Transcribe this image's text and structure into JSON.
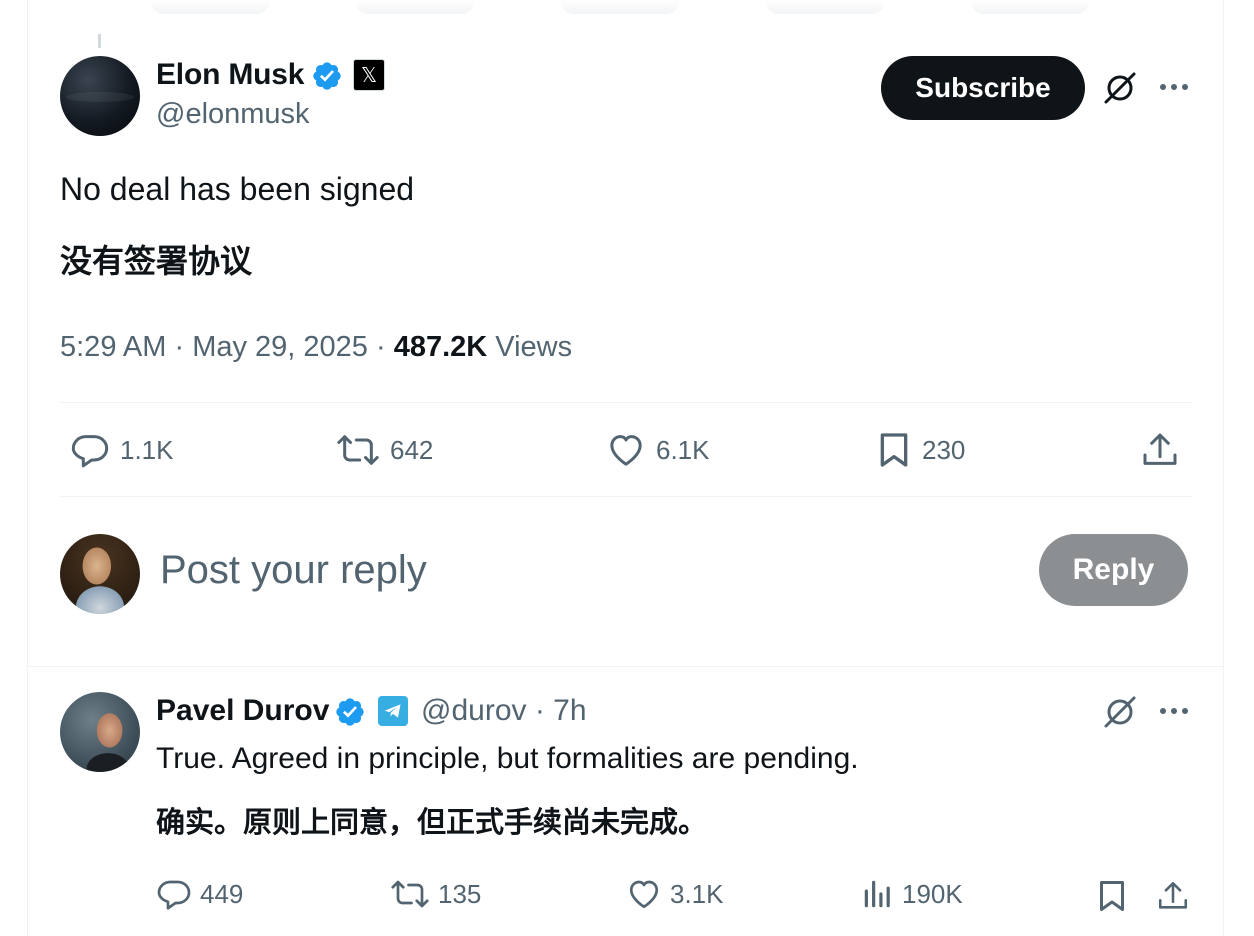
{
  "post": {
    "author": "Elon Musk",
    "handle": "@elonmusk",
    "subscribe_label": "Subscribe",
    "text_en": "No deal has been signed",
    "text_zh": "没有签署协议",
    "time": "5:29 AM",
    "date": "May 29, 2025",
    "views_count": "487.2K",
    "views_label": "Views",
    "replies": "1.1K",
    "reposts": "642",
    "likes": "6.1K",
    "bookmarks": "230"
  },
  "composer": {
    "placeholder": "Post your reply",
    "reply_label": "Reply"
  },
  "reply": {
    "author": "Pavel Durov",
    "handle": "@durov",
    "time": "· 7h",
    "text_en": "True. Agreed in principle, but formalities are pending.",
    "text_zh": "确实。原则上同意，但正式手续尚未完成。",
    "replies": "449",
    "reposts": "135",
    "likes": "3.1K",
    "views": "190K"
  },
  "icons": {
    "verified": "verified-badge-icon",
    "x_affiliate": "x-logo-icon",
    "telegram": "telegram-icon",
    "grok": "grok-icon",
    "more": "more-icon",
    "reply": "reply-icon",
    "repost": "repost-icon",
    "like": "like-icon",
    "bookmark": "bookmark-icon",
    "share": "share-icon",
    "analytics": "analytics-icon"
  },
  "colors": {
    "text": "#0f1419",
    "secondary": "#536471",
    "verified": "#1d9bf0",
    "button_dark": "#0f1419",
    "button_disabled": "#8b8f92",
    "telegram": "#37aee2"
  }
}
